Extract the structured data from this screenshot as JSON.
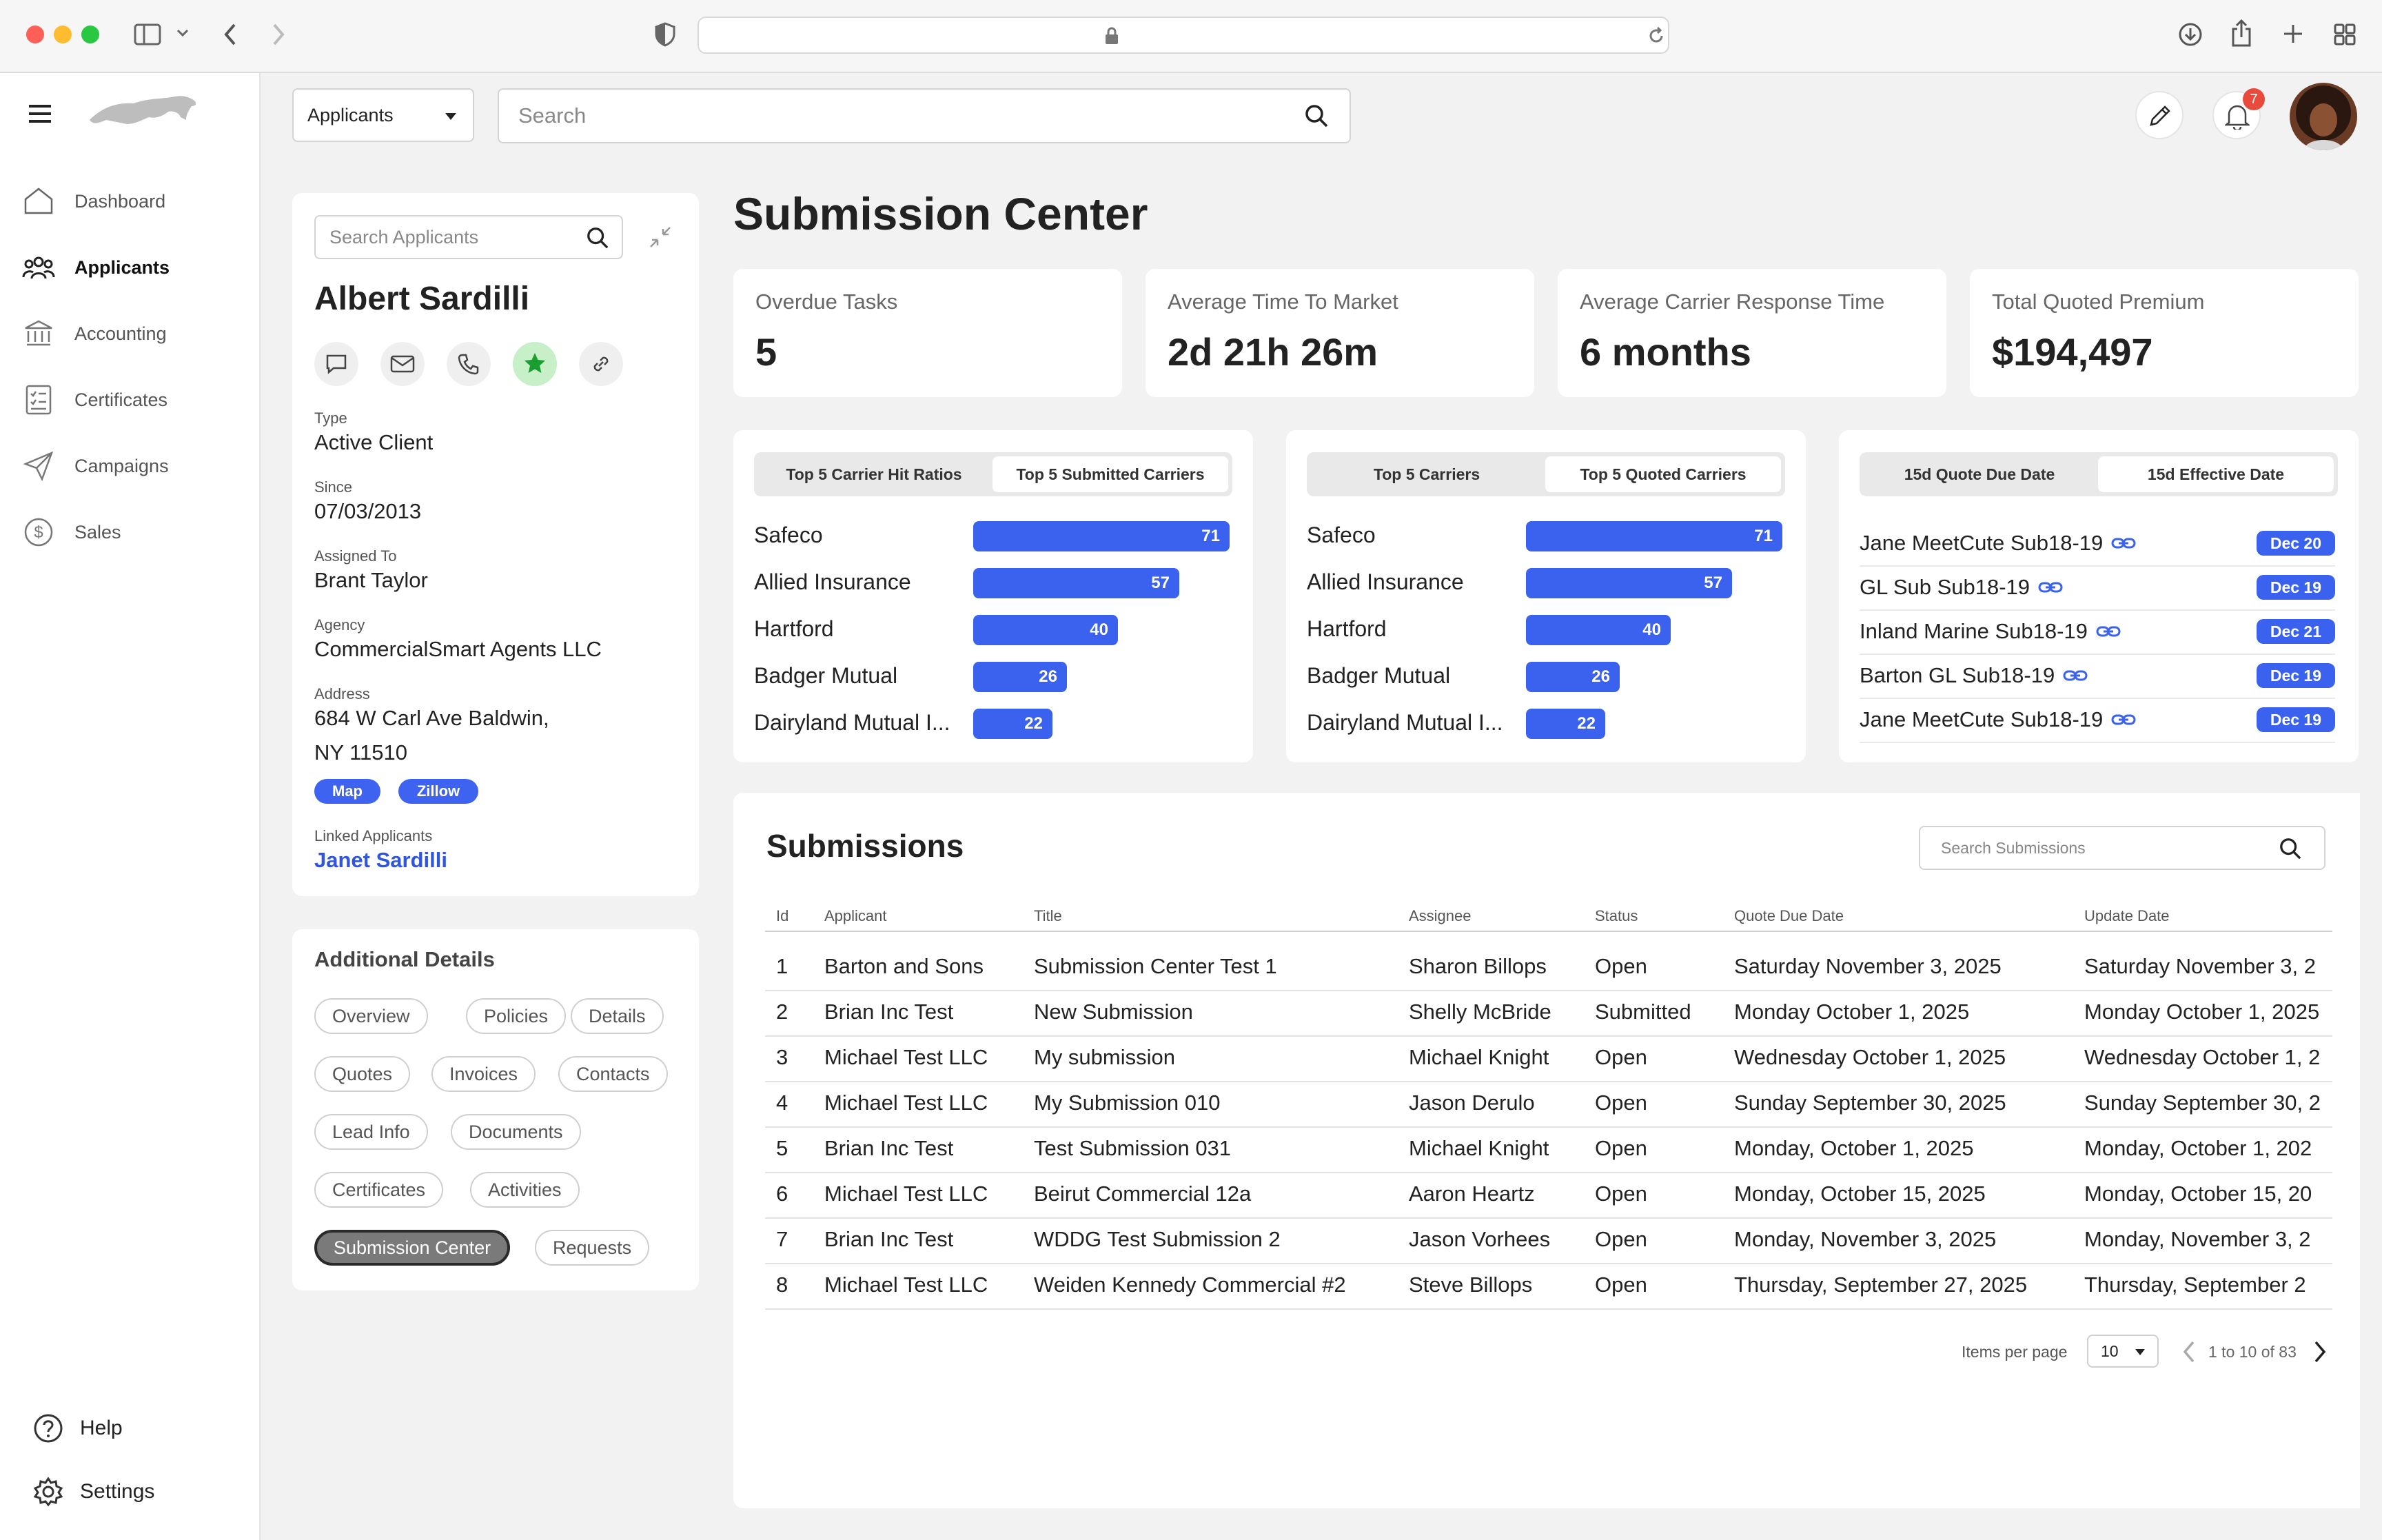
{
  "browser": {
    "url": ""
  },
  "sidebar": {
    "items": [
      {
        "label": "Dashboard"
      },
      {
        "label": "Applicants"
      },
      {
        "label": "Accounting"
      },
      {
        "label": "Certificates"
      },
      {
        "label": "Campaigns"
      },
      {
        "label": "Sales"
      }
    ],
    "bottom": [
      {
        "label": "Help"
      },
      {
        "label": "Settings"
      }
    ]
  },
  "topbar": {
    "scope_selected": "Applicants",
    "search_placeholder": "Search",
    "notification_count": "7"
  },
  "applicant": {
    "search_placeholder": "Search Applicants",
    "name": "Albert Sardilli",
    "fields": [
      {
        "label": "Type",
        "value": "Active Client"
      },
      {
        "label": "Since",
        "value": "07/03/2013"
      },
      {
        "label": "Assigned To",
        "value": "Brant Taylor"
      },
      {
        "label": "Agency",
        "value": "CommercialSmart Agents LLC"
      },
      {
        "label": "Address",
        "value_line1": "684 W Carl Ave Baldwin,",
        "value_line2": "NY 11510"
      }
    ],
    "address_links": [
      "Map",
      "Zillow"
    ],
    "linked_label": "Linked Applicants",
    "linked_name": "Janet Sardilli"
  },
  "additional_details": {
    "title": "Additional Details",
    "buttons": [
      "Overview",
      "Policies",
      "Details",
      "Quotes",
      "Invoices",
      "Contacts",
      "Lead Info",
      "Documents",
      "Certificates",
      "Activities",
      "Submission Center",
      "Requests"
    ],
    "active": "Submission Center"
  },
  "page_title": "Submission Center",
  "stats": [
    {
      "label": "Overdue Tasks",
      "value": "5"
    },
    {
      "label": "Average Time To Market",
      "value": "2d 21h 26m"
    },
    {
      "label": "Average Carrier Response Time",
      "value": "6 months"
    },
    {
      "label": "Total Quoted Premium",
      "value": "$194,497"
    }
  ],
  "carrier_panels": [
    {
      "tabs": [
        "Top 5 Carrier Hit Ratios",
        "Top 5 Submitted Carriers"
      ],
      "selected_tab": 1,
      "bars": [
        {
          "label": "Safeco",
          "value": 71
        },
        {
          "label": "Allied Insurance",
          "value": 57
        },
        {
          "label": "Hartford",
          "value": 40
        },
        {
          "label": "Badger Mutual",
          "value": 26
        },
        {
          "label": "Dairyland Mutual I...",
          "value": 22
        }
      ]
    },
    {
      "tabs": [
        "Top 5 Carriers",
        "Top 5 Quoted Carriers"
      ],
      "selected_tab": 1,
      "bars": [
        {
          "label": "Safeco",
          "value": 71
        },
        {
          "label": "Allied Insurance",
          "value": 57
        },
        {
          "label": "Hartford",
          "value": 40
        },
        {
          "label": "Badger Mutual",
          "value": 26
        },
        {
          "label": "Dairyland Mutual I...",
          "value": 22
        }
      ]
    }
  ],
  "due_panel": {
    "tabs": [
      "15d Quote Due Date",
      "15d Effective Date"
    ],
    "selected_tab": 1,
    "rows": [
      {
        "name": "Jane MeetCute Sub18-19",
        "date": "Dec 20"
      },
      {
        "name": "GL Sub Sub18-19",
        "date": "Dec 19"
      },
      {
        "name": "Inland Marine Sub18-19",
        "date": "Dec 21"
      },
      {
        "name": "Barton GL Sub18-19",
        "date": "Dec 19"
      },
      {
        "name": "Jane MeetCute Sub18-19",
        "date": "Dec 19"
      }
    ]
  },
  "submissions": {
    "title": "Submissions",
    "search_placeholder": "Search Submissions",
    "columns": [
      "Id",
      "Applicant",
      "Title",
      "Assignee",
      "Status",
      "Quote Due Date",
      "Update Date"
    ],
    "rows": [
      [
        "1",
        "Barton and Sons",
        "Submission Center Test 1",
        "Sharon Billops",
        "Open",
        "Saturday November 3, 2025",
        "Saturday November 3, 2"
      ],
      [
        "2",
        "Brian Inc Test",
        "New Submission",
        "Shelly McBride",
        "Submitted",
        "Monday October 1, 2025",
        "Monday October 1, 2025"
      ],
      [
        "3",
        "Michael Test LLC",
        "My submission",
        "Michael Knight",
        "Open",
        "Wednesday October 1, 2025",
        "Wednesday October 1, 2"
      ],
      [
        "4",
        "Michael Test LLC",
        "My Submission 010",
        "Jason Derulo",
        "Open",
        "Sunday September 30, 2025",
        "Sunday September 30, 2"
      ],
      [
        "5",
        "Brian Inc Test",
        "Test Submission 031",
        "Michael Knight",
        "Open",
        "Monday, October 1, 2025",
        "Monday, October 1, 202"
      ],
      [
        "6",
        "Michael Test LLC",
        "Beirut Commercial 12a",
        "Aaron Heartz",
        "Open",
        "Monday, October 15, 2025",
        "Monday, October 15, 20"
      ],
      [
        "7",
        "Brian Inc Test",
        "WDDG Test Submission 2",
        "Jason Vorhees",
        "Open",
        "Monday, November 3, 2025",
        "Monday, November 3, 2"
      ],
      [
        "8",
        "Michael Test LLC",
        "Weiden Kennedy Commercial #2",
        "Steve Billops",
        "Open",
        "Thursday, September 27, 2025",
        "Thursday, September 2"
      ]
    ],
    "pagination": {
      "items_per_page_label": "Items per page",
      "items_per_page": "10",
      "range_text": "1 to 10 of 83"
    }
  },
  "colors": {
    "accent": "#3a62ee",
    "badge": "#e84b3c",
    "star": "#1fbf3a"
  }
}
